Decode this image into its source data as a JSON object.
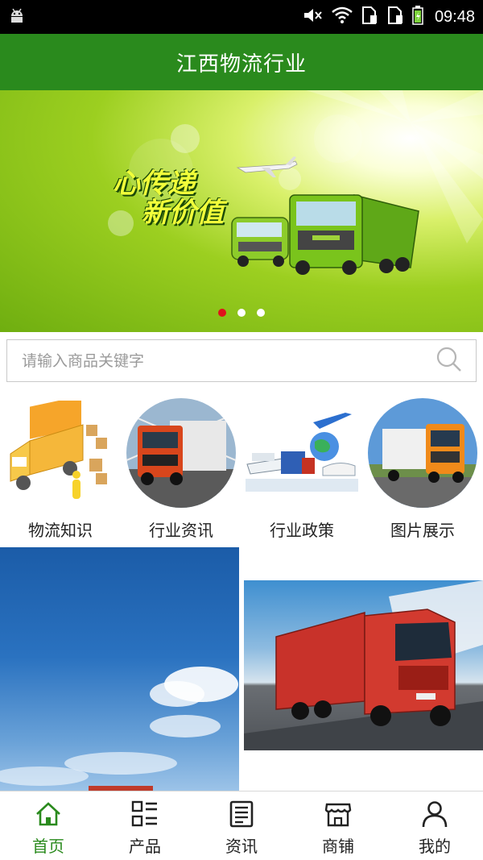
{
  "status_bar": {
    "time": "09:48",
    "icons": [
      "android-icon",
      "mute-icon",
      "wifi-icon",
      "sim1-icon",
      "sim2-icon",
      "battery-icon"
    ]
  },
  "header": {
    "title": "江西物流行业"
  },
  "banner": {
    "slogan_line1": "心传递",
    "slogan_line2": "新价值",
    "slides": 3,
    "active_slide": 1
  },
  "search": {
    "placeholder": "请输入商品关键字"
  },
  "categories": [
    {
      "label": "物流知识",
      "icon": "delivery-truck-boxes-image"
    },
    {
      "label": "行业资讯",
      "icon": "orange-truck-image"
    },
    {
      "label": "行业政策",
      "icon": "transport-modes-image"
    },
    {
      "label": "图片展示",
      "icon": "orange-truck-road-image"
    }
  ],
  "bottom_nav": {
    "items": [
      {
        "label": "首页",
        "icon": "home-icon"
      },
      {
        "label": "产品",
        "icon": "grid-list-icon"
      },
      {
        "label": "资讯",
        "icon": "news-icon"
      },
      {
        "label": "商铺",
        "icon": "shop-icon"
      },
      {
        "label": "我的",
        "icon": "user-icon"
      }
    ],
    "active_index": 0
  },
  "colors": {
    "header_green": "#2a8a1d",
    "active_dot": "#e0121b",
    "active_nav": "#2a8a1d"
  }
}
